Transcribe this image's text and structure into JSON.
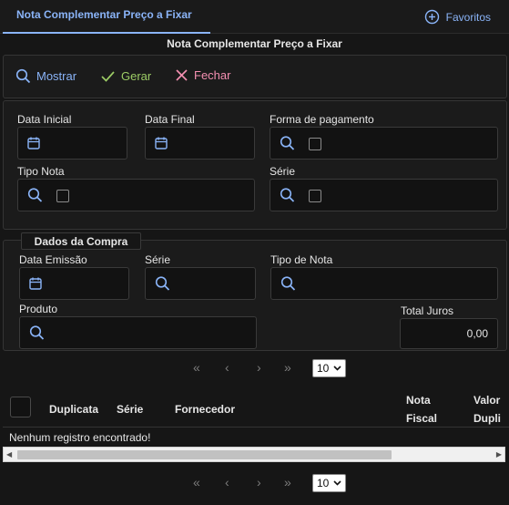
{
  "tabs": {
    "active_label": "Nota Complementar Preço a Fixar",
    "favoritos_label": "Favoritos"
  },
  "page": {
    "title": "Nota Complementar Preço a Fixar"
  },
  "toolbar": {
    "mostrar_label": "Mostrar",
    "gerar_label": "Gerar",
    "fechar_label": "Fechar"
  },
  "filters": {
    "data_inicial_label": "Data Inicial",
    "data_final_label": "Data Final",
    "forma_pagamento_label": "Forma de pagamento",
    "tipo_nota_label": "Tipo Nota",
    "serie_label": "Série"
  },
  "dados_compra": {
    "section_title": "Dados da Compra",
    "data_emissao_label": "Data Emissão",
    "serie_label": "Série",
    "tipo_nota_label": "Tipo de Nota",
    "produto_label": "Produto",
    "total_juros_label": "Total Juros",
    "total_juros_value": "0,00"
  },
  "pager": {
    "page_size": "10"
  },
  "table": {
    "col_duplicata": "Duplicata",
    "col_serie": "Série",
    "col_fornecedor": "Fornecedor",
    "col_nota_line1": "Nota",
    "col_nota_line2": "Fiscal",
    "col_valor_line1": "Valor",
    "col_valor_line2": "Dupli",
    "empty_message": "Nenhum registro encontrado!"
  },
  "colors": {
    "accent": "#8ab4f8",
    "gerar": "#9ccc65",
    "fechar": "#f48fb1"
  }
}
